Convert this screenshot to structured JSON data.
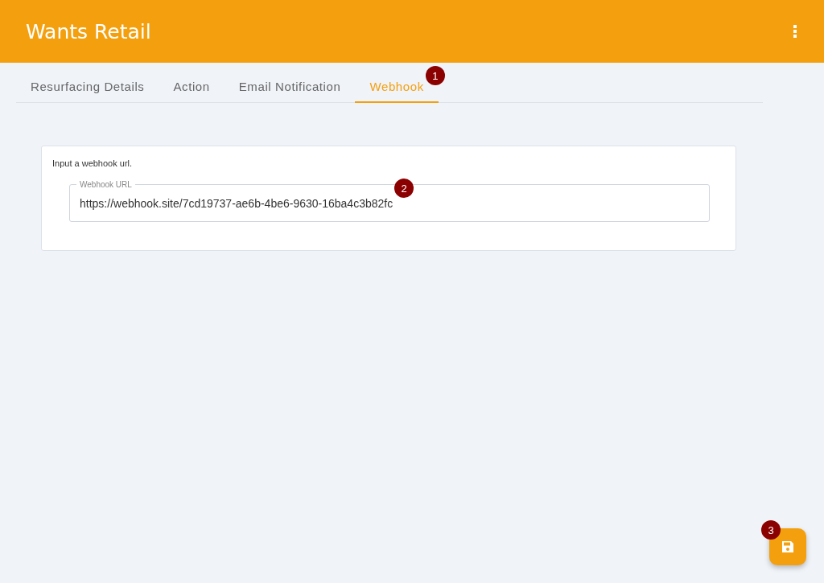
{
  "app_bar": {
    "title": "Wants Retail"
  },
  "tabs": [
    {
      "label": "Resurfacing Details",
      "selected": false
    },
    {
      "label": "Action",
      "selected": false
    },
    {
      "label": "Email Notification",
      "selected": false
    },
    {
      "label": "Webhook",
      "selected": true,
      "callout": "1"
    }
  ],
  "card": {
    "hint": "Input a webhook url.",
    "field": {
      "label": "Webhook URL",
      "value": "https://webhook.site/7cd19737-ae6b-4be6-9630-16ba4c3b82fc",
      "callout": "2"
    }
  },
  "save_button": {
    "callout": "3"
  }
}
